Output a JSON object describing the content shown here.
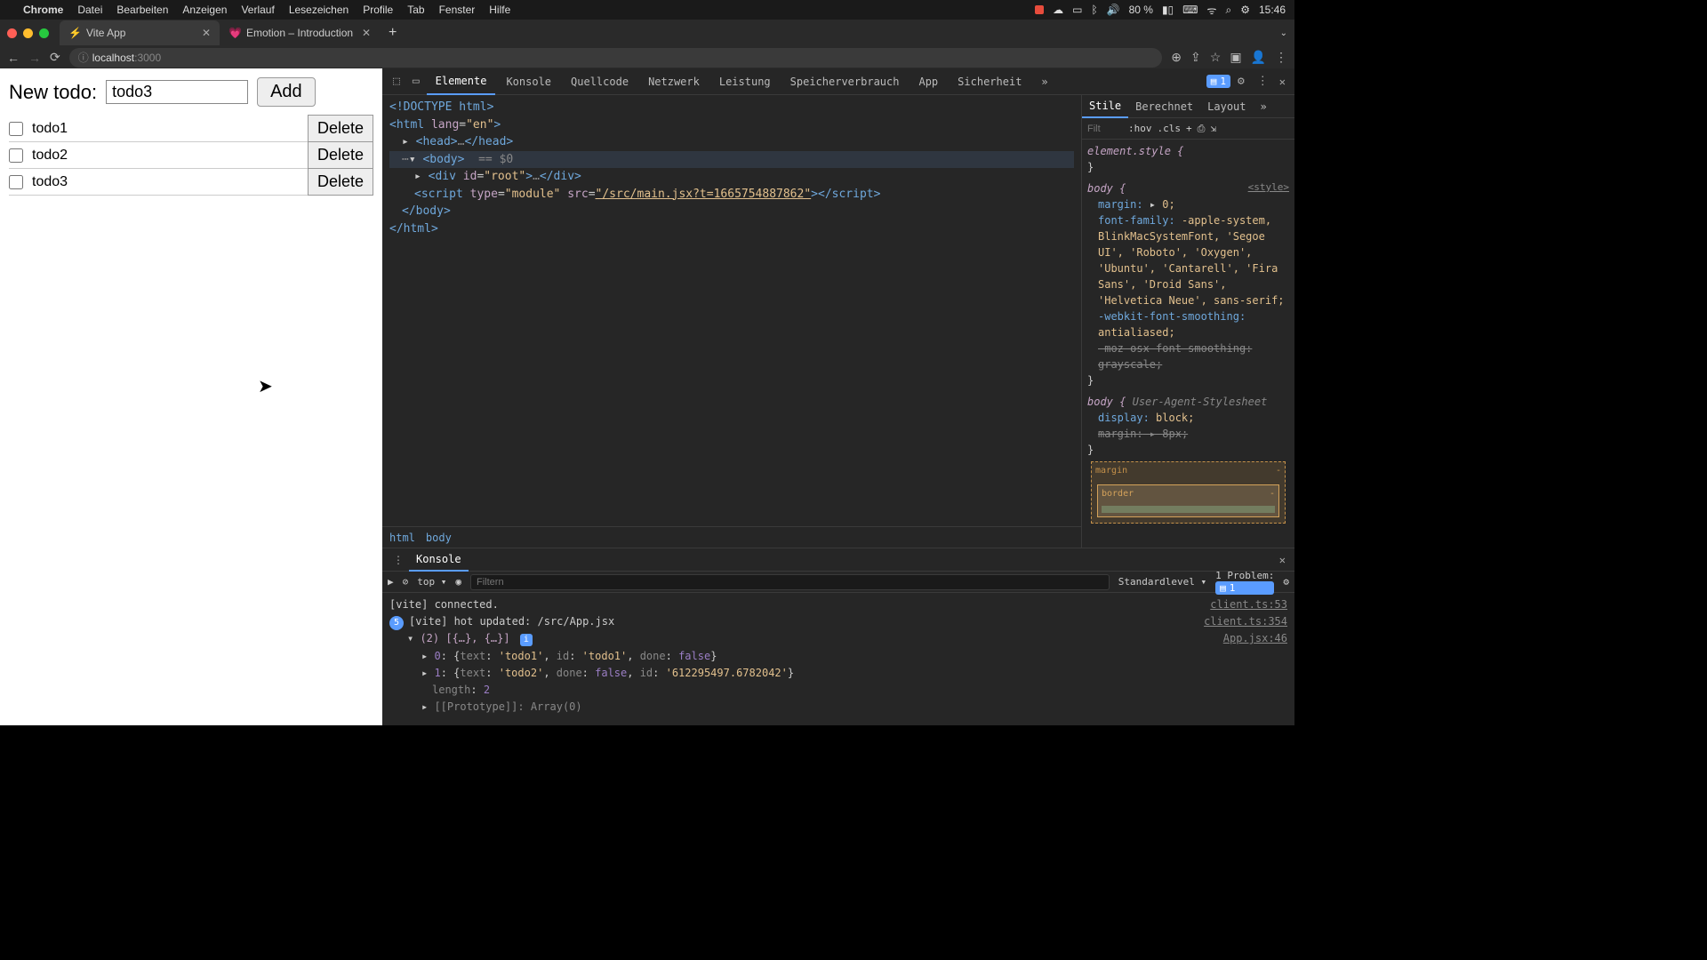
{
  "menubar": {
    "app": "Chrome",
    "items": [
      "Datei",
      "Bearbeiten",
      "Anzeigen",
      "Verlauf",
      "Lesezeichen",
      "Profile",
      "Tab",
      "Fenster",
      "Hilfe"
    ],
    "battery": "80 %",
    "clock": "15:46"
  },
  "tabs": [
    {
      "title": "Vite App",
      "active": true
    },
    {
      "title": "Emotion – Introduction",
      "active": false
    }
  ],
  "address": {
    "host": "localhost",
    "port": ":3000"
  },
  "app": {
    "label": "New todo:",
    "input_value": "todo3",
    "add": "Add",
    "delete": "Delete",
    "todos": [
      "todo1",
      "todo2",
      "todo3"
    ]
  },
  "devtools": {
    "tabs": [
      "Elemente",
      "Konsole",
      "Quellcode",
      "Netzwerk",
      "Leistung",
      "Speicherverbrauch",
      "App",
      "Sicherheit"
    ],
    "more": "»",
    "issues": "1",
    "styles_tabs": [
      "Stile",
      "Berechnet",
      "Layout"
    ],
    "filter_placeholder": "Filt",
    "hov": ":hov",
    "cls": ".cls",
    "breadcrumb": [
      "html",
      "body"
    ],
    "dom": {
      "doctype": "<!DOCTYPE html>",
      "html_open": "<html lang=\"en\">",
      "head": "<head>…</head>",
      "body": "<body>",
      "eq": "== $0",
      "root": "<div id=\"root\">…</div>",
      "script": "<script type=\"module\" src=\"/src/main.jsx?t=1665754887862\"></script>",
      "body_close": "</body>",
      "html_close": "</html>"
    },
    "styles": {
      "element_style": "element.style {",
      "close": "}",
      "body_sel": "body {",
      "style_src": "<style>",
      "margin": "margin:",
      "margin_v": "0;",
      "ff": "font-family:",
      "ff_v": "-apple-system, BlinkMacSystemFont, 'Segoe UI', 'Roboto', 'Oxygen', 'Ubuntu', 'Cantarell', 'Fira Sans', 'Droid Sans', 'Helvetica Neue', sans-serif;",
      "wks": "-webkit-font-smoothing:",
      "wks_v": "antialiased;",
      "moz": "-moz-osx-font-smoothing:",
      "moz_v": "grayscale;",
      "ua_label": "User-Agent-Stylesheet",
      "display": "display:",
      "display_v": "block;",
      "margin2": "margin:",
      "margin2_v": "8px;",
      "box_margin": "margin",
      "box_border": "border",
      "box_dash": "-"
    },
    "console": {
      "title": "Konsole",
      "top": "top",
      "filter": "Filtern",
      "level": "Standardlevel",
      "problem": "1 Problem:",
      "problem_n": "1",
      "lines": [
        {
          "msg": "[vite] connected.",
          "src": "client.ts:53"
        },
        {
          "count": "5",
          "msg": "[vite] hot updated: /src/App.jsx",
          "src": "client.ts:354"
        }
      ],
      "arr_head": "(2) [{…}, {…}]",
      "arr_src": "App.jsx:46",
      "arr0": "0: {text: 'todo1', id: 'todo1', done: false}",
      "arr1": "1: {text: 'todo2', done: false, id: '612295497.6782042'}",
      "len": "length: 2",
      "proto": "[[Prototype]]: Array(0)"
    }
  }
}
